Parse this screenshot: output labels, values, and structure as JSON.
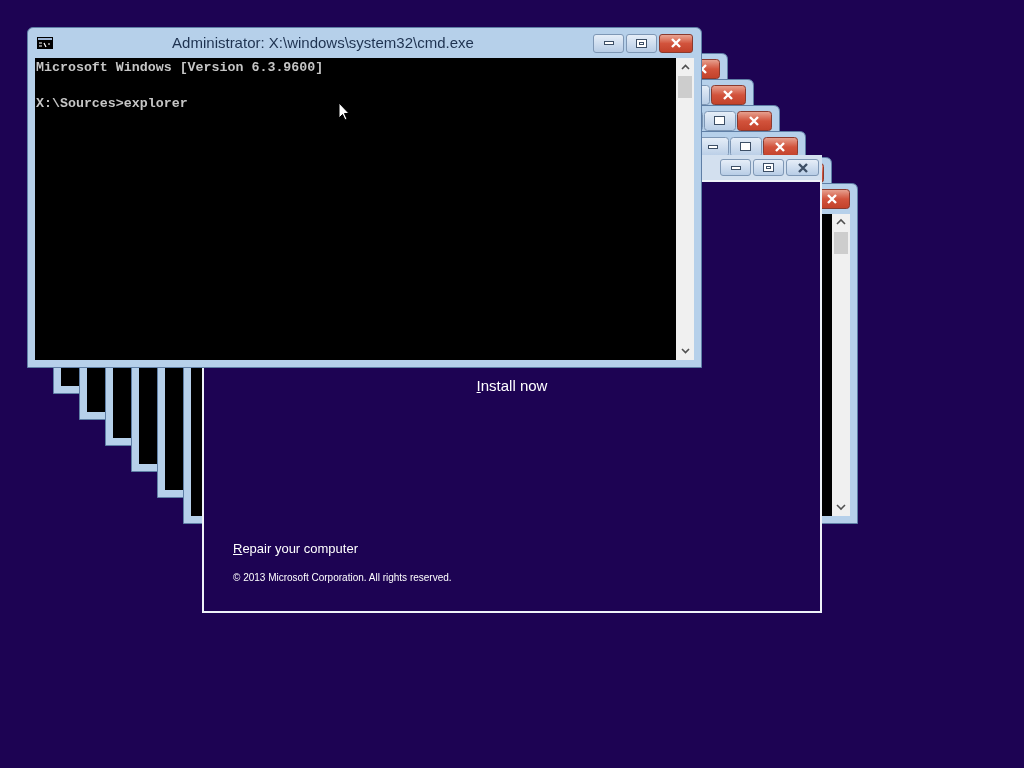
{
  "trail_windows": [
    {
      "kind": "console"
    },
    {
      "kind": "console"
    },
    {
      "kind": "console"
    },
    {
      "kind": "console"
    },
    {
      "kind": "console"
    },
    {
      "kind": "console"
    }
  ],
  "setup_window": {
    "install_button": {
      "label": "Install now",
      "access_key_underlined": true
    },
    "repair_link": {
      "label": "Repair your computer",
      "access_key_underlined": true
    },
    "copyright": "© 2013 Microsoft Corporation. All rights reserved."
  },
  "console_window": {
    "title": "Administrator: X:\\windows\\system32\\cmd.exe",
    "lines": [
      "Microsoft Windows [Version 6.3.9600]",
      "X:\\Sources>explorer"
    ]
  }
}
